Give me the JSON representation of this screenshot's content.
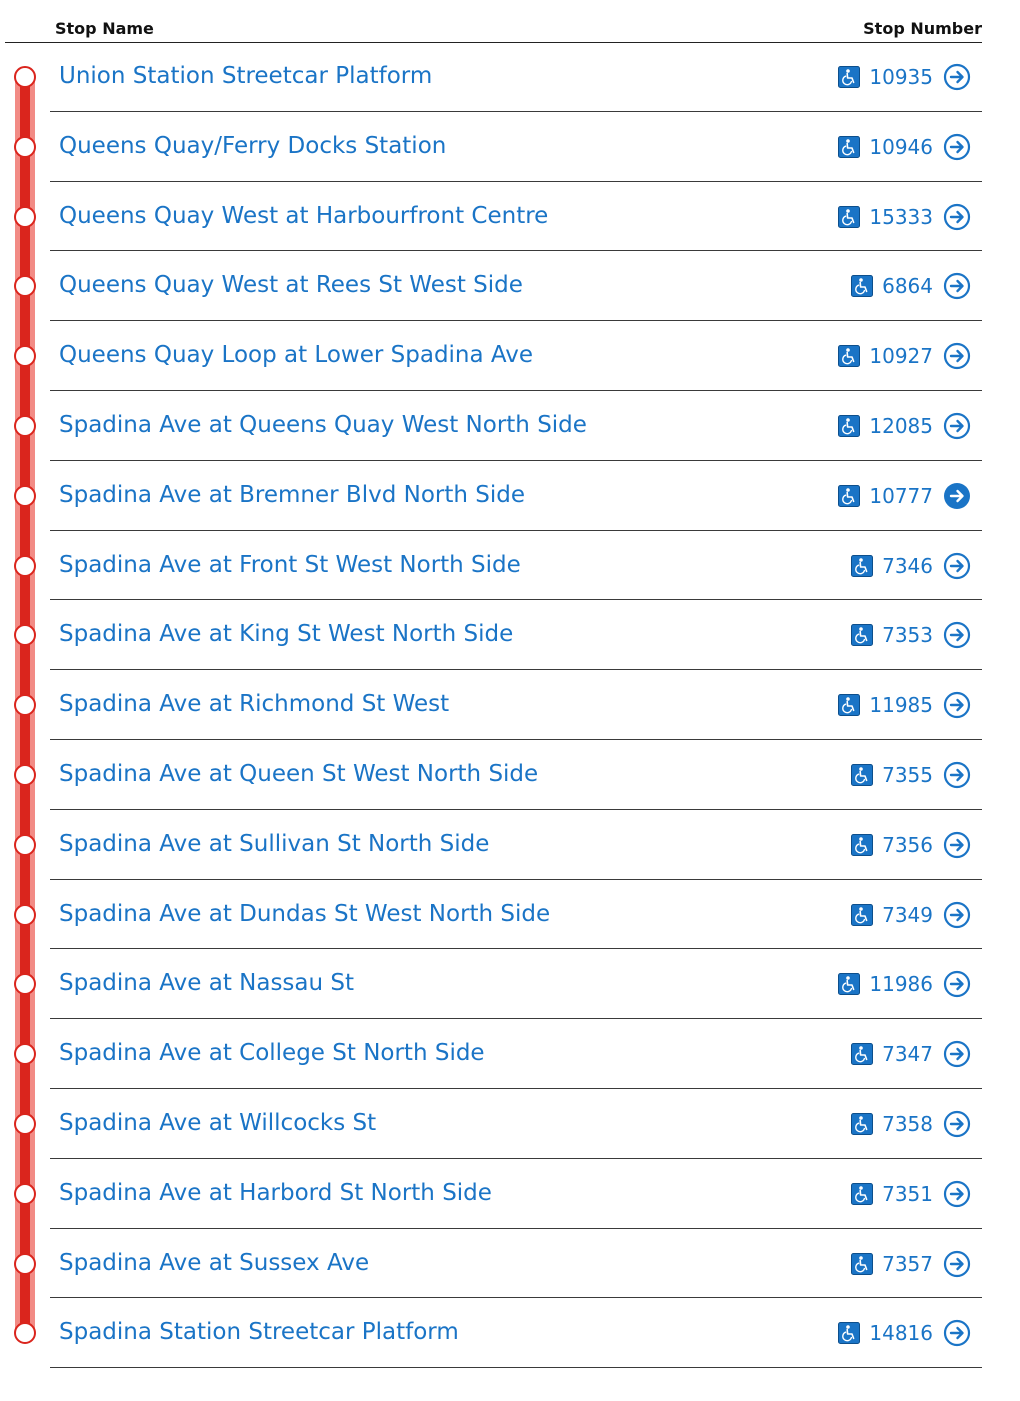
{
  "header": {
    "stop_name_label": "Stop Name",
    "stop_number_label": "Stop Number"
  },
  "colors": {
    "route_line": "#da251d",
    "route_glow": "#f28b85",
    "link": "#1a74c6",
    "highlight_button": "#1a74c6"
  },
  "icons": {
    "accessibility": "wheelchair-accessible-icon",
    "go": "arrow-right-circle-icon"
  },
  "stops": [
    {
      "name": "Union Station Streetcar Platform",
      "number": "10935",
      "accessible": true,
      "selected": false
    },
    {
      "name": "Queens Quay/Ferry Docks Station",
      "number": "10946",
      "accessible": true,
      "selected": false
    },
    {
      "name": "Queens Quay West at Harbourfront Centre",
      "number": "15333",
      "accessible": true,
      "selected": false
    },
    {
      "name": "Queens Quay West at Rees St West Side",
      "number": "6864",
      "accessible": true,
      "selected": false
    },
    {
      "name": "Queens Quay Loop at Lower Spadina Ave",
      "number": "10927",
      "accessible": true,
      "selected": false
    },
    {
      "name": "Spadina Ave at Queens Quay West North Side",
      "number": "12085",
      "accessible": true,
      "selected": false
    },
    {
      "name": "Spadina Ave at Bremner Blvd North Side",
      "number": "10777",
      "accessible": true,
      "selected": true
    },
    {
      "name": "Spadina Ave at Front St West North Side",
      "number": "7346",
      "accessible": true,
      "selected": false
    },
    {
      "name": "Spadina Ave at King St West North Side",
      "number": "7353",
      "accessible": true,
      "selected": false
    },
    {
      "name": "Spadina Ave at Richmond St West",
      "number": "11985",
      "accessible": true,
      "selected": false
    },
    {
      "name": "Spadina Ave at Queen St West North Side",
      "number": "7355",
      "accessible": true,
      "selected": false
    },
    {
      "name": "Spadina Ave at Sullivan St North Side",
      "number": "7356",
      "accessible": true,
      "selected": false
    },
    {
      "name": "Spadina Ave at Dundas St West North Side",
      "number": "7349",
      "accessible": true,
      "selected": false
    },
    {
      "name": "Spadina Ave at Nassau St",
      "number": "11986",
      "accessible": true,
      "selected": false
    },
    {
      "name": "Spadina Ave at College St North Side",
      "number": "7347",
      "accessible": true,
      "selected": false
    },
    {
      "name": "Spadina Ave at Willcocks St",
      "number": "7358",
      "accessible": true,
      "selected": false
    },
    {
      "name": "Spadina Ave at Harbord St North Side",
      "number": "7351",
      "accessible": true,
      "selected": false
    },
    {
      "name": "Spadina Ave at Sussex Ave",
      "number": "7357",
      "accessible": true,
      "selected": false
    },
    {
      "name": "Spadina Station Streetcar Platform",
      "number": "14816",
      "accessible": true,
      "selected": false
    }
  ]
}
